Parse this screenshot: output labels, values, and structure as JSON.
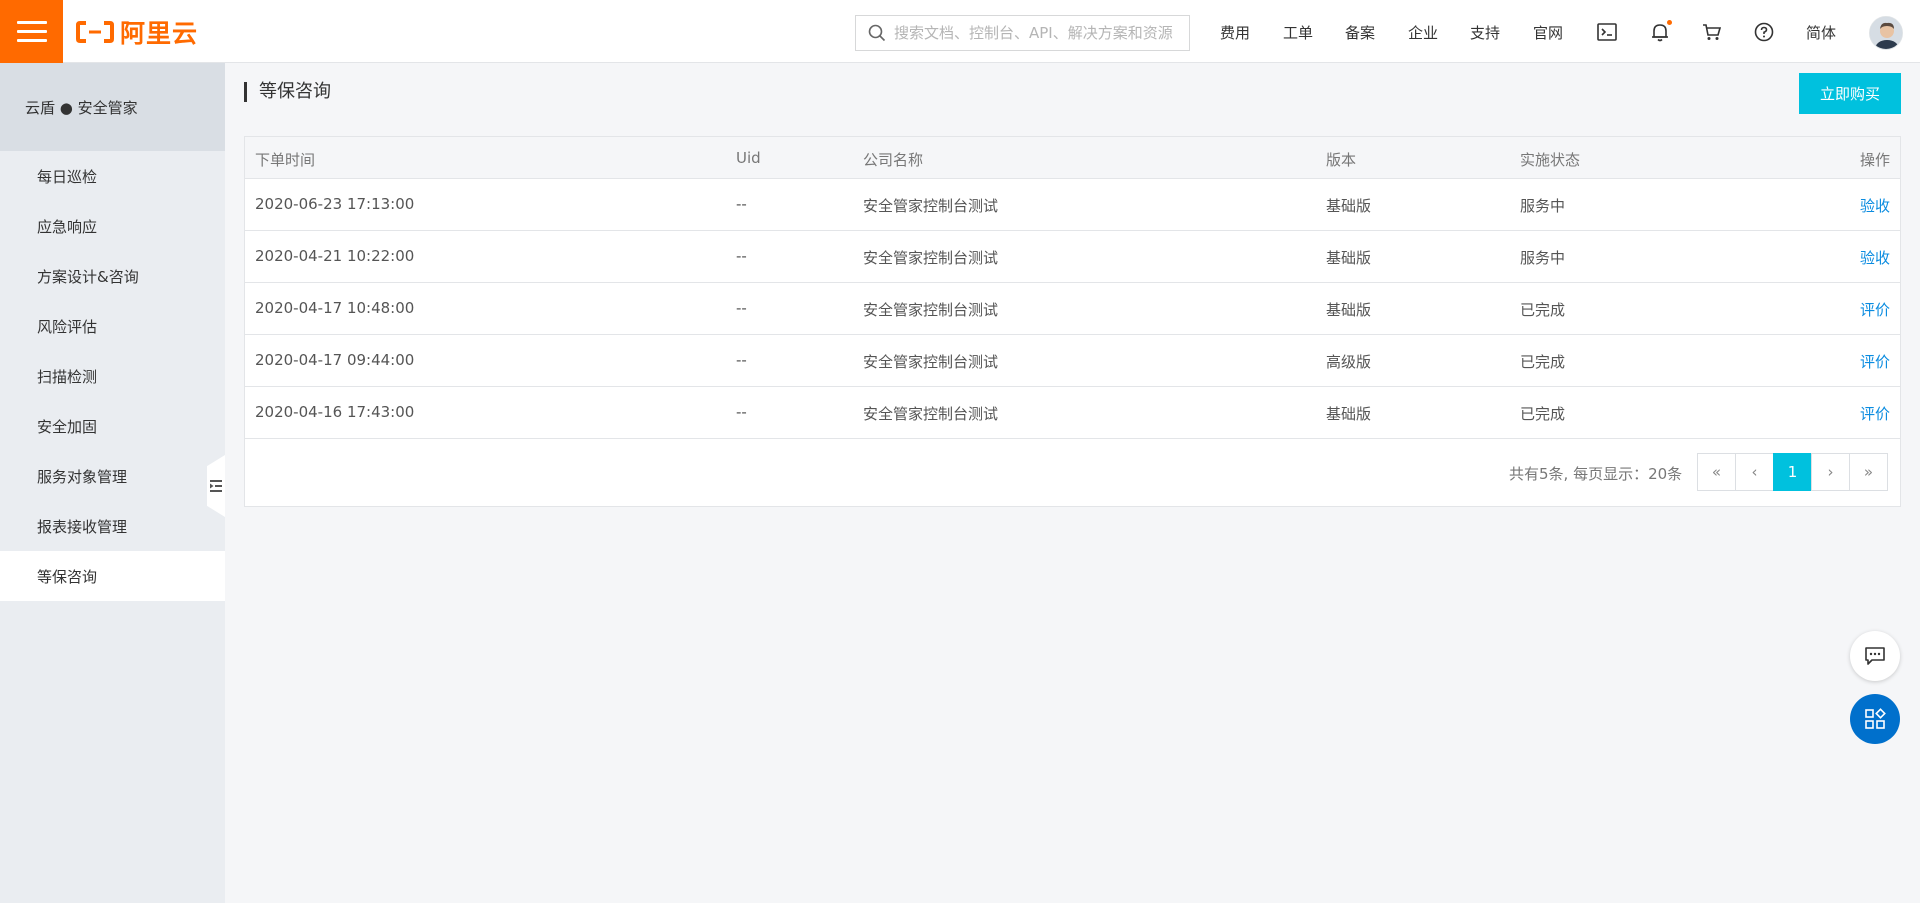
{
  "header": {
    "logo_text": "阿里云",
    "search_placeholder": "搜索文档、控制台、API、解决方案和资源",
    "nav": [
      "费用",
      "工单",
      "备案",
      "企业",
      "支持",
      "官网"
    ],
    "lang": "简体",
    "brand_color": "#ff6a00"
  },
  "sidebar": {
    "title": "云盾 ● 安全管家",
    "items": [
      {
        "label": "每日巡检"
      },
      {
        "label": "应急响应"
      },
      {
        "label": "方案设计&咨询"
      },
      {
        "label": "风险评估"
      },
      {
        "label": "扫描检测"
      },
      {
        "label": "安全加固"
      },
      {
        "label": "服务对象管理"
      },
      {
        "label": "报表接收管理"
      },
      {
        "label": "等保咨询",
        "active": true
      }
    ]
  },
  "main": {
    "title": "等保咨询",
    "buy_label": "立即购买",
    "accent_color": "#00c1de",
    "columns": [
      "下单时间",
      "Uid",
      "公司名称",
      "版本",
      "实施状态",
      "操作"
    ],
    "rows": [
      {
        "time": "2020-06-23 17:13:00",
        "uid": "--",
        "company": "安全管家控制台测试",
        "version": "基础版",
        "status": "服务中",
        "action": "验收"
      },
      {
        "time": "2020-04-21 10:22:00",
        "uid": "--",
        "company": "安全管家控制台测试",
        "version": "基础版",
        "status": "服务中",
        "action": "验收"
      },
      {
        "time": "2020-04-17 10:48:00",
        "uid": "--",
        "company": "安全管家控制台测试",
        "version": "基础版",
        "status": "已完成",
        "action": "评价"
      },
      {
        "time": "2020-04-17 09:44:00",
        "uid": "--",
        "company": "安全管家控制台测试",
        "version": "高级版",
        "status": "已完成",
        "action": "评价"
      },
      {
        "time": "2020-04-16 17:43:00",
        "uid": "--",
        "company": "安全管家控制台测试",
        "version": "基础版",
        "status": "已完成",
        "action": "评价"
      }
    ],
    "pager": {
      "summary": "共有5条, 每页显示：20条",
      "first": "«",
      "prev": "‹",
      "current": "1",
      "next": "›",
      "last": "»"
    }
  }
}
